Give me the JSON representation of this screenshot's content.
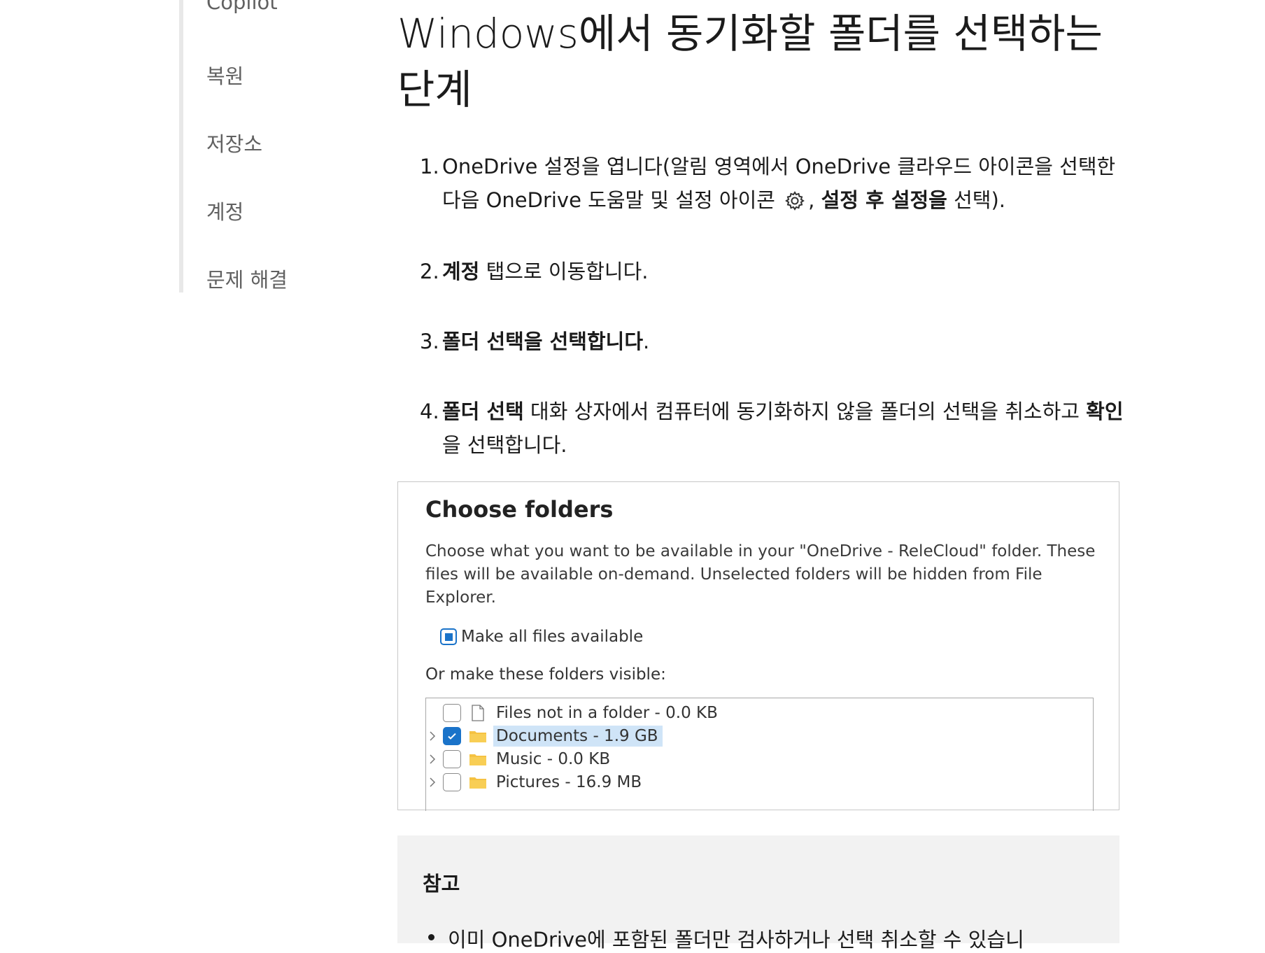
{
  "sidebar": {
    "items": [
      {
        "label": "Copilot"
      },
      {
        "label": "복원"
      },
      {
        "label": "저장소"
      },
      {
        "label": "계정"
      },
      {
        "label": "문제 해결"
      }
    ]
  },
  "main": {
    "title": "Windows에서 동기화할 폴더를 선택하는 단계",
    "steps": [
      {
        "num": "1.",
        "text_a": "OneDrive 설정을 엽니다(알림 영역에서 OneDrive 클라우드 아이콘을 선택한 다음 OneDrive 도움말 및 설정 아이콘 ",
        "icon": "gear-icon",
        "text_b": ", ",
        "bold": "설정 후 설정을",
        "text_c": " 선택)."
      },
      {
        "num": "2.",
        "bold": "계정",
        "text": " 탭으로 이동합니다."
      },
      {
        "num": "3.",
        "bold": "폴더 선택을 선택합니다",
        "text": "."
      },
      {
        "num": "4.",
        "bold_a": "폴더 선택",
        "text_a": " 대화 상자에서 컴퓨터에 동기화하지 않을 폴더의 선택을 취소하고 ",
        "bold_b": "확인",
        "text_b": "을 선택합니다."
      }
    ]
  },
  "dialog": {
    "title": "Choose folders",
    "description": "Choose what you want to be available in your \"OneDrive - ReleCloud\" folder. These files will be available on-demand. Unselected folders will be hidden from File Explorer.",
    "make_all_label": "Make all files available",
    "make_all_state": "indeterminate",
    "or_label": "Or make these folders visible:",
    "rows": [
      {
        "label": "Files not in a folder - 0.0 KB",
        "icon": "file-icon",
        "checked": false,
        "expandable": false,
        "selected": false
      },
      {
        "label": "Documents - 1.9 GB",
        "icon": "folder-icon",
        "checked": true,
        "expandable": true,
        "selected": true
      },
      {
        "label": "Music - 0.0 KB",
        "icon": "folder-icon",
        "checked": false,
        "expandable": true,
        "selected": false
      },
      {
        "label": "Pictures - 16.9 MB",
        "icon": "folder-icon",
        "checked": false,
        "expandable": true,
        "selected": false
      }
    ]
  },
  "note": {
    "title": "참고",
    "items": [
      "이미 OneDrive에 포함된 폴더만 검사하거나 선택 취소할 수 있습니"
    ]
  },
  "colors": {
    "accent": "#1a73c9",
    "selection": "#cfe4f7",
    "folder": "#f5c242",
    "note_bg": "#f2f2f2",
    "sidebar_text": "#616161"
  }
}
